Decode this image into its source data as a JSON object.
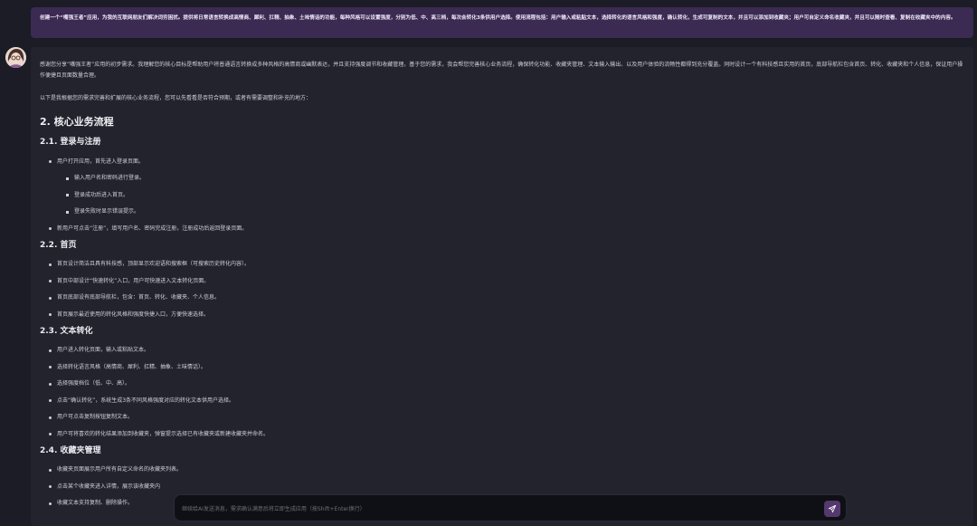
{
  "user_message": "创建一个“嘴强王者”应用，为我的互联网朋友们解决词穷困扰。提供将日常语言转换成高情商、犀利、扛精、抽象、土味情话的功能，每种风格可以设置强度，分别为低、中、高三档，每次会转化3条供用户选择。使用流程包括：用户输入或粘贴文本，选择转化的语言风格和强度，确认转化，生成可复制的文本，并且可以添加到收藏夹；用户可自定义命名收藏夹，并且可以随时查看、复制在收藏夹中的内容。",
  "reply": {
    "intro": "感谢您分享“嘴强王者”应用的初步需求。我理解您的核心目标是帮助用户将普通语言转换成多种风格的高情商或幽默表达，并且支持强度调节和收藏管理。基于您的需求，我会帮您完善核心业务流程，确保转化功能、收藏夹管理、文本输入输出、以及用户体验的流畅性都得到充分覆盖。同时设计一个有科技感且实用的首页，底部导航栏包含首页、转化、收藏夹和个人信息，保证用户操作便捷且页面数量合理。",
    "lead": "以下是我根据您的需求完善和扩展的核心业务流程，您可以先看看是否符合预期，或者有需要调整和补充的地方：",
    "heading": "2. 核心业务流程",
    "s1": {
      "title": "2.1. 登录与注册",
      "b1": "用户打开应用，首先进入登录页面。",
      "sub": [
        "输入用户名和密码进行登录。",
        "登录成功后进入首页。",
        "登录失败时显示错误提示。"
      ],
      "b2": "新用户可点击“注册”，填写用户名、密码完成注册，注册成功后返回登录页面。"
    },
    "s2": {
      "title": "2.2. 首页",
      "items": [
        "首页设计简洁且具有科技感，顶部显示欢迎语和搜索框（可搜索历史转化内容）。",
        "首页中部设计“快速转化”入口，用户可快速进入文本转化页面。",
        "首页底部设有底部导航栏，包含：首页、转化、收藏夹、个人信息。",
        "首页展示最近使用的转化风格和强度快捷入口，方便快速选择。"
      ]
    },
    "s3": {
      "title": "2.3. 文本转化",
      "items": [
        "用户进入转化页面，输入或粘贴文本。",
        "选择转化语言风格（高情商、犀利、扛精、抽象、土味情话）。",
        "选择强度档位（低、中、高）。",
        "点击“确认转化”，系统生成3条不同风格强度对应的转化文本供用户选择。",
        "用户可点击复制按钮复制文本。",
        "用户可将喜欢的转化结果添加到收藏夹，弹窗提示选择已有收藏夹或新建收藏夹并命名。"
      ]
    },
    "s4": {
      "title": "2.4. 收藏夹管理",
      "items": [
        "收藏夹页面展示用户所有自定义命名的收藏夹列表。",
        "点击某个收藏夹进入详情，展示该收藏夹内",
        "收藏文本支持复制、删除操作。"
      ]
    }
  },
  "composer": {
    "placeholder": "继续给AI发送消息，需求确认满意后将立即生成应用（按Shift+Enter换行）",
    "send_icon": "send-icon"
  },
  "colors": {
    "accent": "#55386e",
    "user_bubble": "#3b2a52",
    "background": "#1b1c25"
  }
}
